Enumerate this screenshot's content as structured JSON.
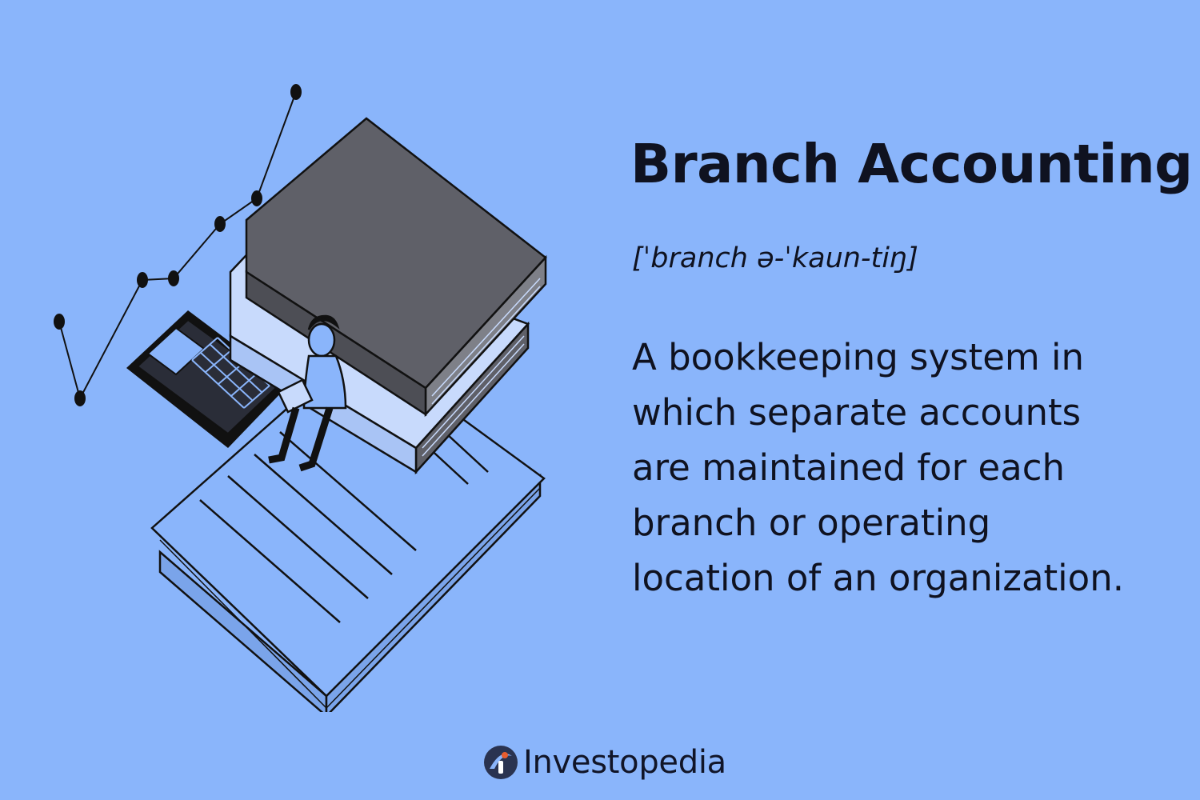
{
  "term": {
    "title": "Branch Accounting",
    "pronunciation": "[ˈbranch ə-ˈkaun-tiŋ]",
    "definition_lines": [
      "A bookkeeping system in",
      "which separate accounts",
      "are maintained for each",
      "branch or operating",
      "location of an organization."
    ]
  },
  "brand": {
    "name": "Investopedia",
    "logo_icon": "investopedia-logo-icon"
  },
  "illustration": {
    "icons": [
      "line-chart-icon",
      "calculator-icon",
      "book-stack-icon",
      "document-icon",
      "person-with-laptop-icon"
    ]
  },
  "colors": {
    "background": "#8ab5fb",
    "text": "#0f1220",
    "book_gray": "#5f6068",
    "logo_accent": "#e85d2f"
  }
}
